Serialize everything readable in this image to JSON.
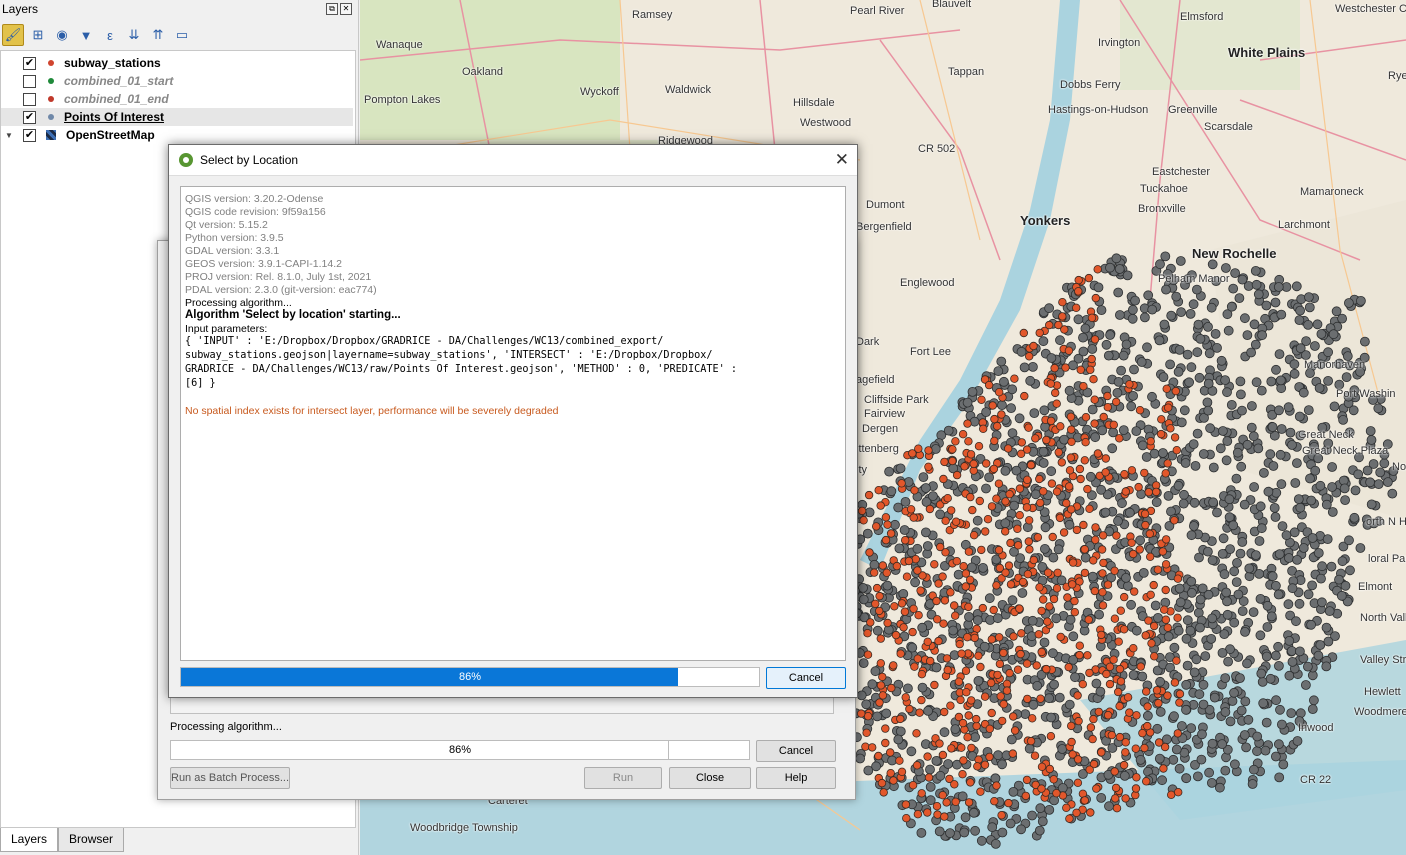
{
  "layers_panel": {
    "title": "Layers",
    "float_icon": "⧉",
    "close_icon": "✕",
    "items": [
      {
        "name": "subway_stations",
        "checked": true,
        "color": "#d0452f",
        "style": "bold"
      },
      {
        "name": "combined_01_start",
        "checked": false,
        "color": "#1f8a3a",
        "style": "italic"
      },
      {
        "name": "combined_01_end",
        "checked": false,
        "color": "#c0392b",
        "style": "italic"
      },
      {
        "name": "Points Of Interest",
        "checked": true,
        "color": "#6f88a8",
        "style": "bold-underline"
      },
      {
        "name": "OpenStreetMap",
        "checked": true,
        "color": "#3d6fb5",
        "style": "bold"
      }
    ],
    "tabs": {
      "layers": "Layers",
      "browser": "Browser"
    }
  },
  "map": {
    "labels": {
      "ramsey": "Ramsey",
      "pearl_river": "Pearl River",
      "blauvelt": "Blauvelt",
      "elmsford": "Elmsford",
      "westchester_airport": "Westchester County Airport",
      "irvington": "Irvington",
      "white_plains": "White Plains",
      "rye_brook": "Rye B",
      "wanaque": "Wanaque",
      "oakland": "Oakland",
      "tappan": "Tappan",
      "dobbs_ferry": "Dobbs Ferry",
      "wyckoff": "Wyckoff",
      "waldwick": "Waldwick",
      "pompton_lakes": "Pompton Lakes",
      "hillsdale": "Hillsdale",
      "hastings": "Hastings-on-Hudson",
      "greenville": "Greenville",
      "scarsdale": "Scarsdale",
      "westwood": "Westwood",
      "ridgewood": "Ridgewood",
      "cr502": "CR 502",
      "eastchester": "Eastchester",
      "tuckahoe": "Tuckahoe",
      "mamaroneck": "Mamaroneck",
      "dumont": "Dumont",
      "bronxville": "Bronxville",
      "yonkers": "Yonkers",
      "bergenfield": "Bergenfield",
      "larchmont": "Larchmont",
      "new_rochelle": "New Rochelle",
      "pelham_manor": "Pelham Manor",
      "englewood": "Englewood",
      "fort_lee": "Fort Lee",
      "manorhaven": "Manorhaven",
      "port_washington": "Port Washin",
      "cliffside_park": "Cliffside Park",
      "fairview": "Fairview",
      "great_neck": "Great Neck",
      "great_neck_plaza": "Great Neck Plaza",
      "nor": "Nor",
      "north_new_hyde_park": "orth N Hyde Pa",
      "floral_park": "loral Park",
      "elmont": "Elmont",
      "north_valley_stream": "North Valley Stream",
      "valley_stream": "Valley Stream",
      "hewlett": "Hewlett",
      "woodmere": "Woodmere",
      "inwood": "Inwood",
      "cr22": "CR 22",
      "carteret": "Carteret",
      "woodbridge": "Woodbridge Township",
      "dark": "Dark",
      "agefield": "agefield",
      "dergen": "Dergen",
      "ittenberg": "ittenberg",
      "ity": "ity"
    }
  },
  "under_dialog": {
    "status": "Processing algorithm...",
    "progress_label": "86%",
    "progress_value": 0.86,
    "cancel": "Cancel",
    "batch": "Run as Batch Process...",
    "run": "Run",
    "close": "Close",
    "help": "Help"
  },
  "select_dialog": {
    "title": "Select by Location",
    "close": "✕",
    "log": {
      "qgis_version": "QGIS version: 3.20.2-Odense",
      "qgis_revision": "QGIS code revision: 9f59a156",
      "qt_version": "Qt version: 5.15.2",
      "python_version": "Python version: 3.9.5",
      "gdal_version": "GDAL version: 3.3.1",
      "geos_version": "GEOS version: 3.9.1-CAPI-1.14.2",
      "proj_version": "PROJ version: Rel. 8.1.0, July 1st, 2021",
      "pdal_version": "PDAL version: 2.3.0 (git-version: eac774)",
      "processing": "Processing algorithm...",
      "starting": "Algorithm 'Select by location' starting...",
      "input_params": "Input parameters:",
      "params_line1": "{ 'INPUT' : 'E:/Dropbox/Dropbox/GRADRICE - DA/Challenges/WC13/combined_export/",
      "params_line2": "subway_stations.geojson|layername=subway_stations', 'INTERSECT' : 'E:/Dropbox/Dropbox/",
      "params_line3": "GRADRICE - DA/Challenges/WC13/raw/Points Of Interest.geojson', 'METHOD' : 0, 'PREDICATE' :",
      "params_line4": "[6] }",
      "warning": "No spatial index exists for intersect layer, performance will be severely degraded"
    },
    "progress_label": "86%",
    "progress_value": 0.86,
    "cancel": "Cancel"
  },
  "colors": {
    "accent": "#0a77d8",
    "poi_fill": "#6b6e70",
    "subway_fill": "#e2572b"
  }
}
